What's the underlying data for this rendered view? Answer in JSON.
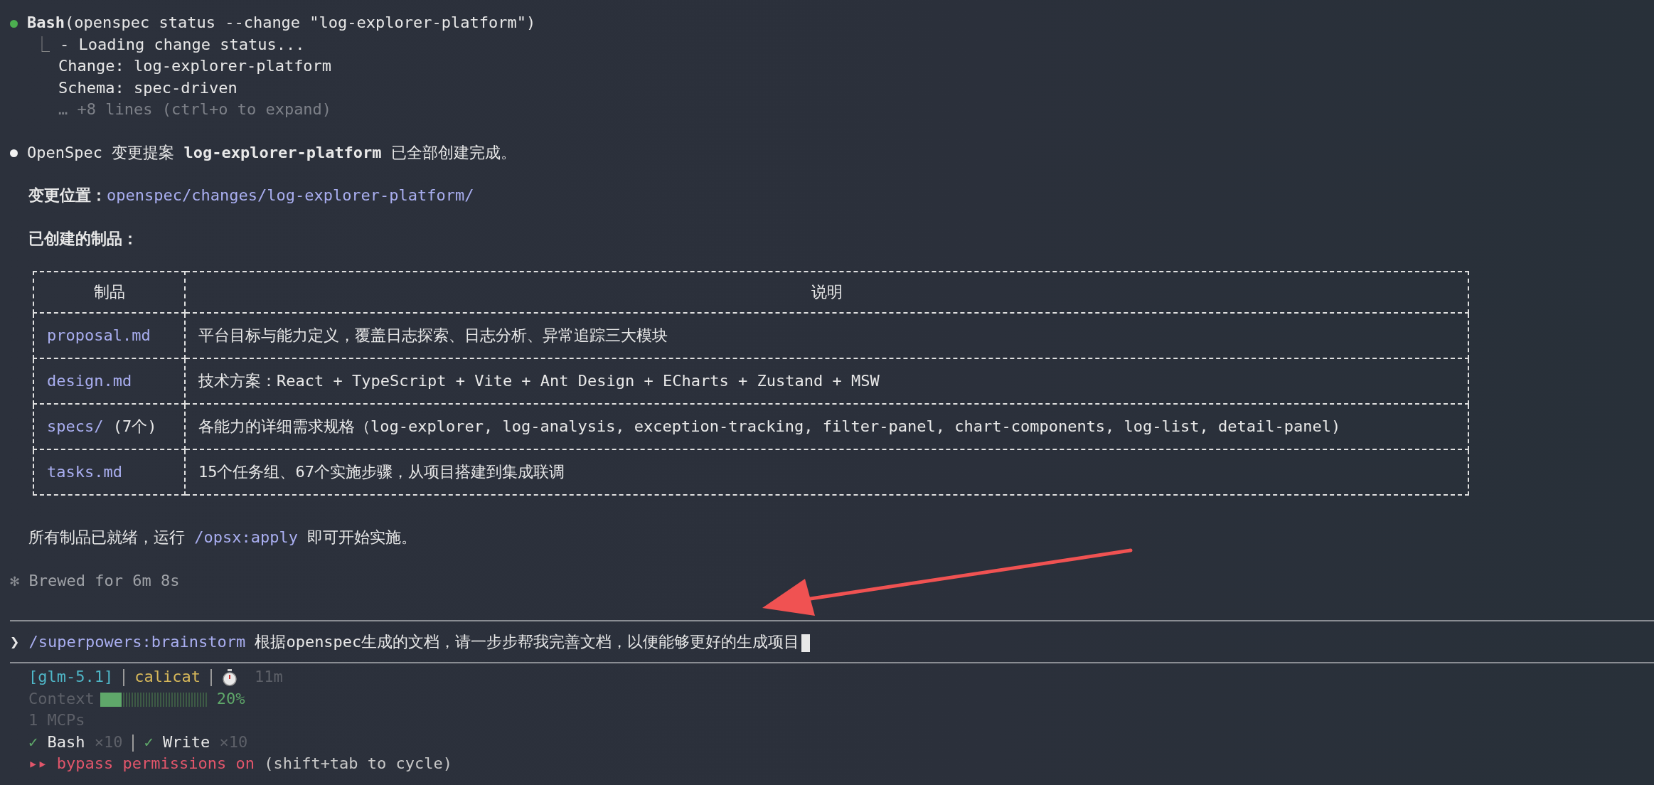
{
  "tool_call": {
    "name": "Bash",
    "args": "(openspec status --change \"log-explorer-platform\")",
    "done": true,
    "tree_mark": "⎿",
    "output": [
      "- Loading change status...",
      "Change: log-explorer-platform",
      "Schema: spec-driven"
    ],
    "collapsed_note": "… +8 lines (ctrl+o to expand)"
  },
  "message": {
    "text": "OpenSpec 变更提案 **log-explorer-platform** 已全部创建完成。"
  },
  "location": {
    "label": "变更位置：",
    "path": "openspec/changes/log-explorer-platform/"
  },
  "artifacts_heading": "已创建的制品：",
  "table": {
    "columns": [
      "制品",
      "说明"
    ],
    "rows": [
      {
        "file": "proposal.md",
        "description": "平台目标与能力定义，覆盖日志探索、日志分析、异常追踪三大模块"
      },
      {
        "file": "design.md",
        "description": "技术方案：React + TypeScript + Vite + Ant Design + ECharts + Zustand + MSW"
      },
      {
        "file": "specs/",
        "file_note": "(7个)",
        "description": "各能力的详细需求规格（log-explorer, log-analysis, exception-tracking, filter-panel, chart-components, log-list, detail-panel)"
      },
      {
        "file": "tasks.md",
        "description": "15个任务组、67个实施步骤，从项目搭建到集成联调"
      }
    ]
  },
  "closing": {
    "before": "所有制品已就绪，运行",
    "command": "/opsx:apply",
    "after": "即可开始实施。"
  },
  "brewed": {
    "symbol": "✻",
    "text": "Brewed for 6m 8s"
  },
  "prompt": {
    "symbol": "❯",
    "command": "/superpowers:brainstorm",
    "text": "根据openspec生成的文档，请一步步帮我完善文档，以便能够更好的生成项目"
  },
  "status": {
    "model": "[glm-5.1]",
    "user": "calicat",
    "elapsed": "11m",
    "context_label": "Context",
    "context": {
      "level": 0.2
    },
    "context_percent": "20%",
    "mcps": "1 MCPs",
    "tools": [
      {
        "mark": "✓",
        "name": "Bash",
        "count": "×10"
      },
      {
        "mark": "✓",
        "name": "Write",
        "count": "×10"
      }
    ],
    "mode": {
      "symbol": "▸▸",
      "text": "bypass permissions on",
      "hint": "(shift+tab to cycle)"
    }
  }
}
